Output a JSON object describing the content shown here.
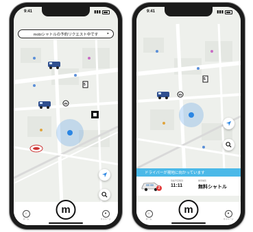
{
  "status": {
    "time": "9:41"
  },
  "left_screen": {
    "banner": "mobiシャトルの予約リクエスト中です",
    "banner_arrow": "▸",
    "poi_text": "5",
    "home_label": "m",
    "nav": {
      "left_label": "ホーム",
      "right_label": "マイページ"
    }
  },
  "right_screen": {
    "notice": "ドライバーが現地に向かっています",
    "poi_text": "5",
    "home_label": "m",
    "info": {
      "vehicle_badge": "2",
      "time_label": "到着予定時刻",
      "time_value": "11:11",
      "type_label": "乗車種別",
      "type_value": "無料シャトル"
    },
    "nav": {
      "left_label": "ホーム",
      "right_label": "マイページ"
    }
  },
  "colors": {
    "accent_blue": "#4bb9e8",
    "location_blue": "#2b86e3",
    "badge_red": "#e23b3b"
  },
  "icons": [
    "location-arrow-icon",
    "search-icon",
    "shuttle-icon",
    "bus-stop-icon",
    "user-location-icon"
  ]
}
